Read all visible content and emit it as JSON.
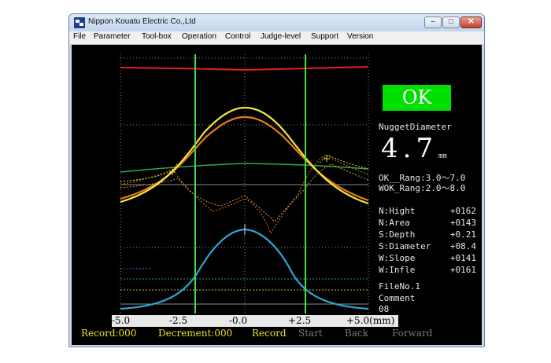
{
  "window": {
    "title": "Nippon Kouatu Electric Co.,Ltd",
    "controls": {
      "minimize": "–",
      "maximize": "□",
      "close": "✕"
    }
  },
  "menu": [
    "File",
    "Parameter",
    "Tool-box",
    "Operation",
    "Control",
    "Judge-level",
    "Support",
    "Version"
  ],
  "judgement": "OK",
  "nugget": {
    "label": "NuggetDiameter",
    "value": "4.7",
    "unit": "mm",
    "ok_range": "OK__Rang:3.0～7.0",
    "wok_range": "WOK_Rang:2.0～8.0"
  },
  "measurements": [
    {
      "name": "N:Hight",
      "value": "+0162"
    },
    {
      "name": "N:Area",
      "value": "+0143"
    },
    {
      "name": "S:Depth",
      "value": "+0.21"
    },
    {
      "name": "S:Diameter",
      "value": "+08.4"
    },
    {
      "name": "W:Slope",
      "value": "+0141"
    },
    {
      "name": "W:Infle",
      "value": "+0161"
    }
  ],
  "file": {
    "file_no": "FileNo.1",
    "comment_label": "Comment",
    "comment_value": "08"
  },
  "axis": {
    "ticks": [
      "-5.0",
      "-2.5",
      "-0.0",
      "+2.5",
      "+5.0(mm)"
    ]
  },
  "status_bar": {
    "record_count": "Record:000",
    "decrement": "Decrement:000",
    "record_button": "Record",
    "start_button": "Start",
    "back_button": "Back",
    "forward_button": "Forward"
  },
  "colors": {
    "background": "#000000",
    "ok_green": "#00e000",
    "cursor_green": "#44dd44",
    "active_text": "#e8e030",
    "inactive_text": "#777777",
    "red_line": "#e02020",
    "yellow_curve": "#f2e640",
    "orange_curve": "#e87a1a",
    "blue_curve": "#2aa6d8"
  }
}
